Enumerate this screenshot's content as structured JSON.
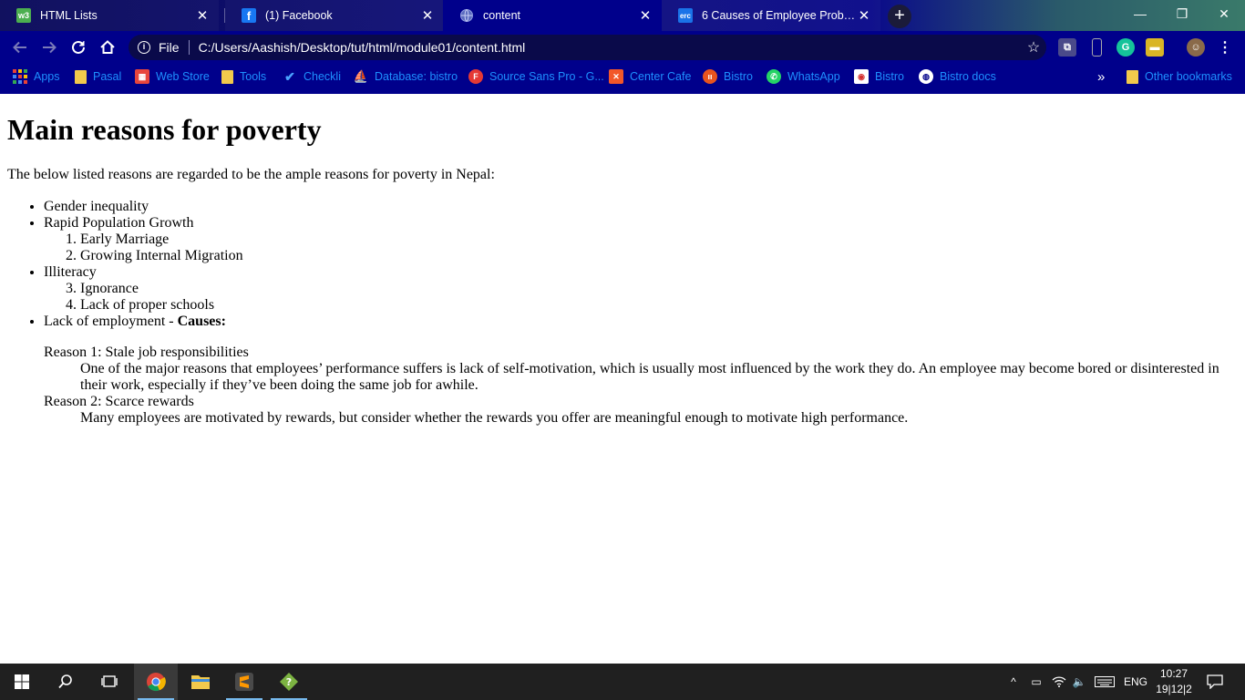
{
  "browser": {
    "tabs": [
      {
        "title": "HTML Lists",
        "favicon": "w3",
        "favicon_color": "#4caf50",
        "active": false
      },
      {
        "title": "(1) Facebook",
        "favicon": "f",
        "favicon_color": "#1877f2",
        "active": false
      },
      {
        "title": "content",
        "favicon": "globe",
        "favicon_color": "#5b6bbf",
        "active": true
      },
      {
        "title": "6 Causes of Employee Problems",
        "favicon": "erc",
        "favicon_color": "#1a73e8",
        "active": false
      }
    ],
    "omnibox": {
      "scheme_label": "File",
      "url": "C:/Users/Aashish/Desktop/tut/html/module01/content.html"
    },
    "bookmarks": [
      {
        "label": "Apps",
        "icon": "apps-grid-icon"
      },
      {
        "label": "Pasal",
        "icon": "folder-icon"
      },
      {
        "label": "Web Store",
        "icon": "web-store-icon"
      },
      {
        "label": "Tools",
        "icon": "folder-icon"
      },
      {
        "label": "Checkli",
        "icon": "check-icon"
      },
      {
        "label": "Database: bistro",
        "icon": "database-icon"
      },
      {
        "label": "Source Sans Pro - G...",
        "icon": "font-icon"
      },
      {
        "label": "Center Cafe",
        "icon": "xampp-icon"
      },
      {
        "label": "Bistro",
        "icon": "bistro-icon"
      },
      {
        "label": "WhatsApp",
        "icon": "whatsapp-icon"
      },
      {
        "label": "Bistro",
        "icon": "bistro-alt-icon"
      },
      {
        "label": "Bistro docs",
        "icon": "globe-icon"
      }
    ],
    "overflow_label": "»",
    "other_bookmarks": "Other bookmarks",
    "accent_color": "#00008b",
    "link_color": "#1e90ff"
  },
  "page": {
    "heading": "Main reasons for poverty",
    "intro": "The below listed reasons are regarded to be the ample reasons for poverty in Nepal:",
    "reasons": {
      "gender": "Gender inequality",
      "population": "Rapid Population Growth",
      "population_sub": [
        "Early Marriage",
        "Growing Internal Migration"
      ],
      "illiteracy": "Illiteracy",
      "illiteracy_sub": [
        "Ignorance",
        "Lack of proper schools"
      ],
      "employment_prefix": "Lack of employment - ",
      "employment_bold": "Causes:"
    },
    "causes": [
      {
        "term": "Reason 1: Stale job responsibilities",
        "desc": "One of the major reasons that employees’ performance suffers is lack of self-motivation, which is usually most influenced by the work they do. An employee may become bored or disinterested in their work, especially if they’ve been doing the same job for awhile."
      },
      {
        "term": "Reason 2: Scarce rewards",
        "desc": "Many employees are motivated by rewards, but consider whether the rewards you offer are meaningful enough to motivate high performance."
      }
    ]
  },
  "taskbar": {
    "language": "ENG",
    "time": "10:27",
    "date": "19|12|2"
  }
}
